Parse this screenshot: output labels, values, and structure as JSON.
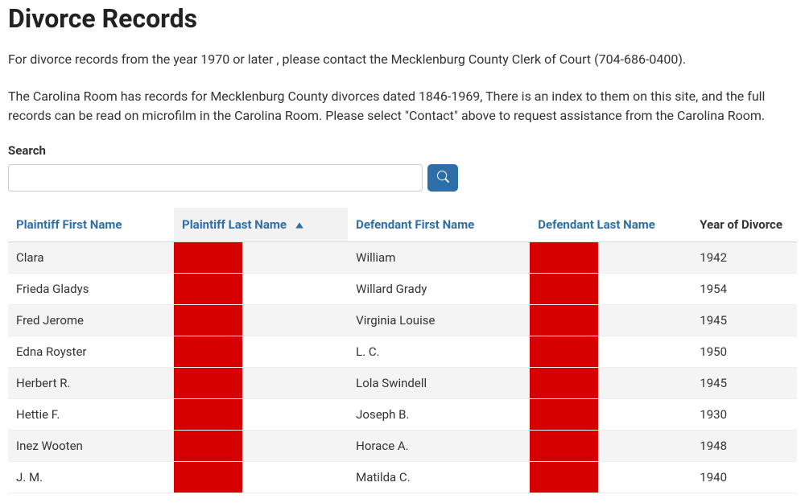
{
  "page": {
    "title": "Divorce Records",
    "intro1": "For divorce records from the year 1970 or later , please contact the Mecklenburg County Clerk of Court (704-686-0400).",
    "intro2": "The Carolina Room has records for Mecklenburg County divorces dated 1846-1969, There is an index to them on this site, and the full records can be read on microfilm in the Carolina Room. Please select \"Contact\" above to request assistance from the Carolina Room."
  },
  "search": {
    "label": "Search",
    "value": "",
    "placeholder": ""
  },
  "table": {
    "headers": {
      "plaintiff_first": "Plaintiff First Name",
      "plaintiff_last": "Plaintiff Last Name",
      "defendant_first": "Defendant First Name",
      "defendant_last": "Defendant Last Name",
      "year": "Year of Divorce"
    },
    "sort_column": "plaintiff_last",
    "sort_dir": "asc",
    "rows": [
      {
        "plaintiff_first": "Clara",
        "plaintiff_last": "",
        "defendant_first": "William",
        "defendant_last": "",
        "year": "1942"
      },
      {
        "plaintiff_first": "Frieda Gladys",
        "plaintiff_last": "",
        "defendant_first": "Willard Grady",
        "defendant_last": "",
        "year": "1954"
      },
      {
        "plaintiff_first": "Fred Jerome",
        "plaintiff_last": "",
        "defendant_first": "Virginia Louise",
        "defendant_last": "",
        "year": "1945"
      },
      {
        "plaintiff_first": "Edna Royster",
        "plaintiff_last": "",
        "defendant_first": "L. C.",
        "defendant_last": "",
        "year": "1950"
      },
      {
        "plaintiff_first": "Herbert R.",
        "plaintiff_last": "",
        "defendant_first": "Lola Swindell",
        "defendant_last": "",
        "year": "1945"
      },
      {
        "plaintiff_first": "Hettie F.",
        "plaintiff_last": "",
        "defendant_first": "Joseph B.",
        "defendant_last": "",
        "year": "1930"
      },
      {
        "plaintiff_first": "Inez Wooten",
        "plaintiff_last": "",
        "defendant_first": "Horace A.",
        "defendant_last": "",
        "year": "1948"
      },
      {
        "plaintiff_first": "J. M.",
        "plaintiff_last": "",
        "defendant_first": "Matilda C.",
        "defendant_last": "",
        "year": "1940"
      }
    ]
  },
  "colors": {
    "link": "#2f6fa7",
    "redaction": "#d60000"
  }
}
